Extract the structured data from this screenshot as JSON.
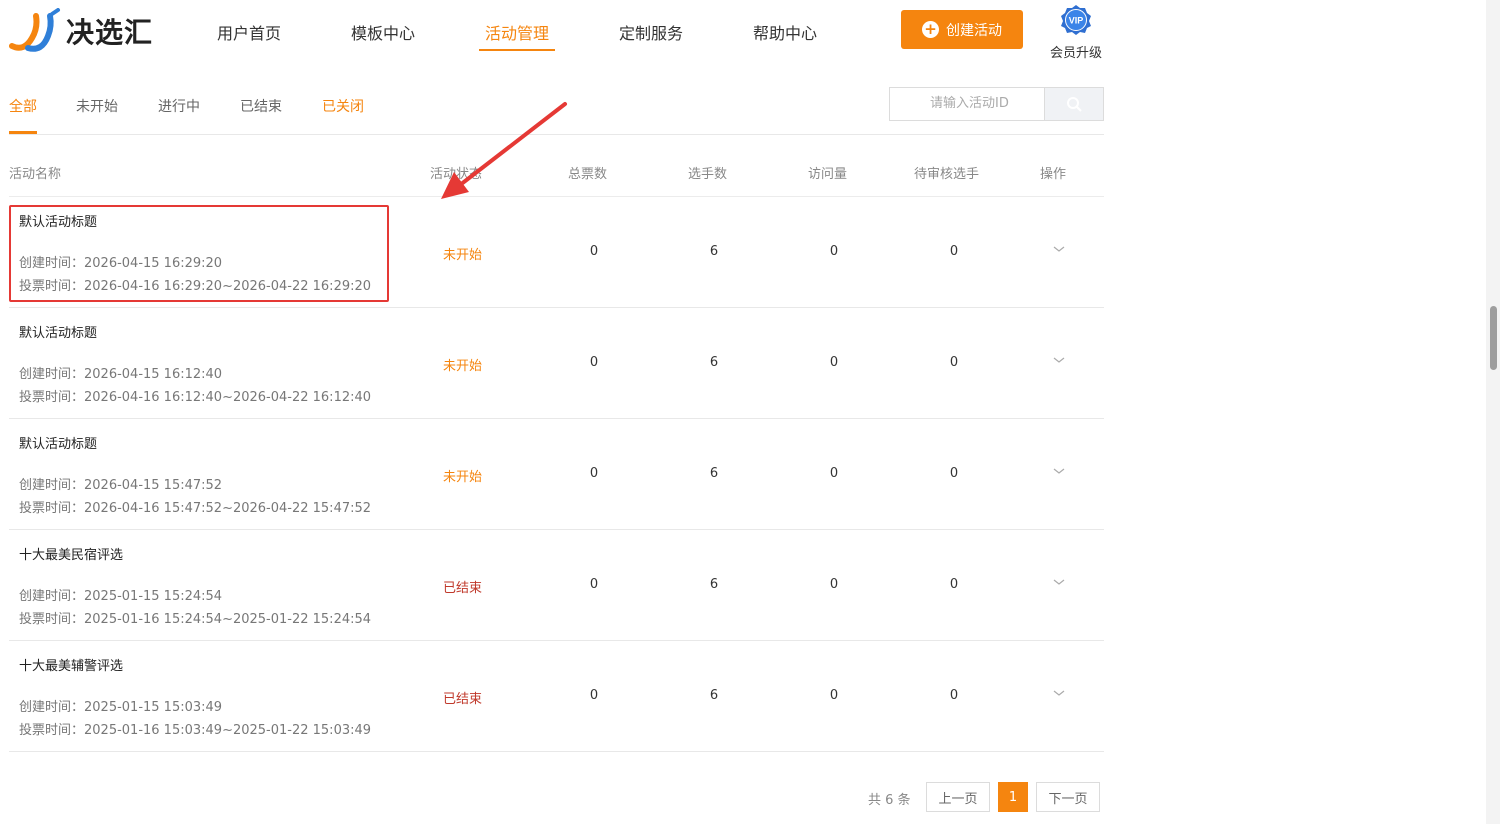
{
  "brand": {
    "name": "决选汇"
  },
  "nav": {
    "items": [
      {
        "label": "用户首页"
      },
      {
        "label": "模板中心"
      },
      {
        "label": "活动管理"
      },
      {
        "label": "定制服务"
      },
      {
        "label": "帮助中心"
      }
    ],
    "active_index": 2
  },
  "header": {
    "create_label": "创建活动",
    "vip_badge": "VIP",
    "vip_label": "会员升级"
  },
  "filters": {
    "tabs": [
      {
        "label": "全部"
      },
      {
        "label": "未开始"
      },
      {
        "label": "进行中"
      },
      {
        "label": "已结束"
      },
      {
        "label": "已关闭"
      }
    ],
    "active": "全部",
    "search_placeholder": "请输入活动ID"
  },
  "table": {
    "columns": [
      {
        "label": "活动名称"
      },
      {
        "label": "活动状态"
      },
      {
        "label": "总票数"
      },
      {
        "label": "选手数"
      },
      {
        "label": "访问量"
      },
      {
        "label": "待审核选手"
      },
      {
        "label": "操作"
      }
    ],
    "rows": [
      {
        "title": "默认活动标题",
        "created": "创建时间：2026-04-15 16:29:20",
        "vote_time": "投票时间：2026-04-16 16:29:20~2026-04-22 16:29:20",
        "status": "未开始",
        "total_votes": "0",
        "contestants": "6",
        "visits": "0",
        "pending": "0"
      },
      {
        "title": "默认活动标题",
        "created": "创建时间：2026-04-15 16:12:40",
        "vote_time": "投票时间：2026-04-16 16:12:40~2026-04-22 16:12:40",
        "status": "未开始",
        "total_votes": "0",
        "contestants": "6",
        "visits": "0",
        "pending": "0"
      },
      {
        "title": "默认活动标题",
        "created": "创建时间：2026-04-15 15:47:52",
        "vote_time": "投票时间：2026-04-16 15:47:52~2026-04-22 15:47:52",
        "status": "未开始",
        "total_votes": "0",
        "contestants": "6",
        "visits": "0",
        "pending": "0"
      },
      {
        "title": "十大最美民宿评选",
        "created": "创建时间：2025-01-15 15:24:54",
        "vote_time": "投票时间：2025-01-16 15:24:54~2025-01-22 15:24:54",
        "status": "已结束",
        "total_votes": "0",
        "contestants": "6",
        "visits": "0",
        "pending": "0"
      },
      {
        "title": "十大最美辅警评选",
        "created": "创建时间：2025-01-15 15:03:49",
        "vote_time": "投票时间：2025-01-16 15:03:49~2025-01-22 15:03:49",
        "status": "已结束",
        "total_votes": "0",
        "contestants": "6",
        "visits": "0",
        "pending": "0"
      }
    ]
  },
  "pagination": {
    "total_label": "共 6 条",
    "prev_label": "上一页",
    "current": "1",
    "next_label": "下一页"
  },
  "colors": {
    "accent": "#f5850f",
    "status_pending": "#f5850f",
    "status_ended": "#c0392b",
    "highlight": "#e53935"
  },
  "icons": {
    "search": "search-icon",
    "plus": "plus-circle-icon",
    "chevron": "chevron-down-icon",
    "vip": "vip-badge-icon"
  }
}
